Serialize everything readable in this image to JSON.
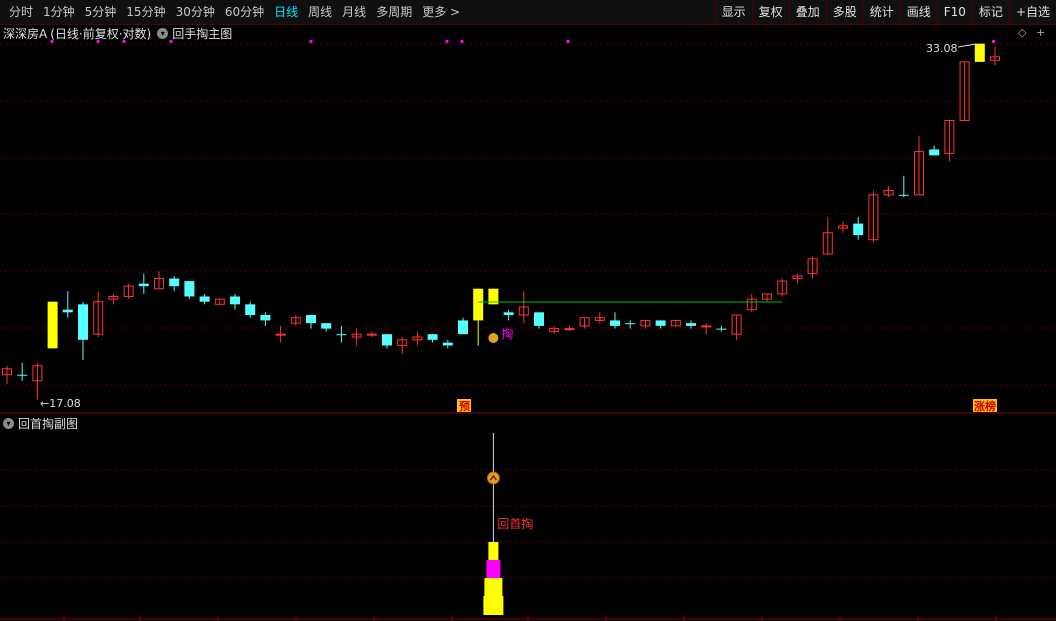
{
  "toolbar": {
    "periods": [
      "分时",
      "1分钟",
      "5分钟",
      "15分钟",
      "30分钟",
      "60分钟",
      "日线",
      "周线",
      "月线",
      "多周期",
      "更多 >"
    ],
    "active_period": "日线",
    "buttons": [
      "显示",
      "复权",
      "叠加",
      "多股",
      "统计",
      "画线",
      "F10",
      "标记",
      "+自选"
    ]
  },
  "main_panel": {
    "stock_name": "深深房A",
    "params": "(日线·前复权·对数)",
    "indicator_name": "回手掏主图",
    "indicator_icon": "chevron-down-icon"
  },
  "sub_panel": {
    "indicator_name": "回首掏副图",
    "indicator_icon": "chevron-down-icon",
    "signal_label": "回首掏"
  },
  "colors": {
    "up": "#ff3232",
    "down": "#54ffff",
    "highlight": "#ffff00",
    "magenta": "#ff00ff",
    "grid": "#5a0000",
    "line": "#00c000"
  },
  "chart_data": {
    "type": "candlestick",
    "scale": "log",
    "annotations": {
      "low_label": "17.08",
      "high_label": "33.08",
      "marker_yu": "预",
      "marker_zt": "涨榜",
      "mid_label": "掏"
    },
    "candles": [
      [
        17.9,
        18.1,
        17.6,
        18.2,
        "up"
      ],
      [
        17.9,
        17.9,
        17.7,
        18.3,
        "down"
      ],
      [
        17.7,
        18.2,
        17.1,
        18.3,
        "up"
      ],
      [
        18.8,
        20.5,
        18.8,
        20.5,
        "hl"
      ],
      [
        20.2,
        20.1,
        19.9,
        20.9,
        "down"
      ],
      [
        20.4,
        19.1,
        18.4,
        20.5,
        "down"
      ],
      [
        19.3,
        20.5,
        19.2,
        20.9,
        "up"
      ],
      [
        20.6,
        20.7,
        20.4,
        20.8,
        "up"
      ],
      [
        20.7,
        21.1,
        20.6,
        21.2,
        "up"
      ],
      [
        21.2,
        21.1,
        20.8,
        21.6,
        "down"
      ],
      [
        21.0,
        21.4,
        21.0,
        21.7,
        "up"
      ],
      [
        21.4,
        21.1,
        20.9,
        21.5,
        "down"
      ],
      [
        21.3,
        20.7,
        20.6,
        21.3,
        "down"
      ],
      [
        20.7,
        20.5,
        20.4,
        20.8,
        "down"
      ],
      [
        20.4,
        20.6,
        20.4,
        20.6,
        "up"
      ],
      [
        20.7,
        20.4,
        20.2,
        20.8,
        "down"
      ],
      [
        20.4,
        20.0,
        19.9,
        20.5,
        "down"
      ],
      [
        20.0,
        19.8,
        19.6,
        20.1,
        "down"
      ],
      [
        19.3,
        19.3,
        19.0,
        19.6,
        "up"
      ],
      [
        19.7,
        19.9,
        19.6,
        20.0,
        "up"
      ],
      [
        20.0,
        19.7,
        19.5,
        20.0,
        "down"
      ],
      [
        19.7,
        19.5,
        19.4,
        19.7,
        "down"
      ],
      [
        19.3,
        19.3,
        19.0,
        19.6,
        "down"
      ],
      [
        19.2,
        19.3,
        18.9,
        19.5,
        "up"
      ],
      [
        19.3,
        19.3,
        19.2,
        19.4,
        "up"
      ],
      [
        19.3,
        18.9,
        18.8,
        19.3,
        "down"
      ],
      [
        18.9,
        19.1,
        18.6,
        19.2,
        "up"
      ],
      [
        19.1,
        19.2,
        18.9,
        19.4,
        "up"
      ],
      [
        19.3,
        19.1,
        19.0,
        19.3,
        "down"
      ],
      [
        19.0,
        18.9,
        18.8,
        19.1,
        "down"
      ],
      [
        19.3,
        19.8,
        19.3,
        19.9,
        "down"
      ],
      [
        19.8,
        21.0,
        18.9,
        21.0,
        "hl"
      ],
      [
        21.0,
        20.4,
        20.4,
        21.0,
        "hl"
      ],
      [
        20.0,
        20.1,
        19.8,
        20.2,
        "down"
      ],
      [
        20.0,
        20.3,
        19.7,
        20.9,
        "up"
      ],
      [
        20.1,
        19.6,
        19.5,
        20.1,
        "down"
      ],
      [
        19.4,
        19.5,
        19.3,
        19.6,
        "up"
      ],
      [
        19.5,
        19.5,
        19.4,
        19.6,
        "up"
      ],
      [
        19.6,
        19.9,
        19.5,
        19.9,
        "up"
      ],
      [
        19.8,
        19.9,
        19.7,
        20.1,
        "up"
      ],
      [
        19.8,
        19.6,
        19.5,
        20.1,
        "down"
      ],
      [
        19.7,
        19.7,
        19.5,
        19.8,
        "down"
      ],
      [
        19.6,
        19.8,
        19.5,
        19.8,
        "up"
      ],
      [
        19.8,
        19.6,
        19.5,
        19.8,
        "down"
      ],
      [
        19.6,
        19.8,
        19.6,
        19.8,
        "up"
      ],
      [
        19.7,
        19.6,
        19.5,
        19.8,
        "down"
      ],
      [
        19.6,
        19.6,
        19.3,
        19.7,
        "up"
      ],
      [
        19.5,
        19.5,
        19.4,
        19.6,
        "down"
      ],
      [
        19.3,
        20.0,
        19.1,
        20.0,
        "up"
      ],
      [
        20.2,
        20.6,
        20.1,
        20.8,
        "up"
      ],
      [
        20.6,
        20.8,
        20.5,
        20.8,
        "up"
      ],
      [
        20.8,
        21.3,
        20.7,
        21.4,
        "up"
      ],
      [
        21.4,
        21.5,
        21.2,
        21.6,
        "up"
      ],
      [
        21.6,
        22.2,
        21.4,
        22.3,
        "up"
      ],
      [
        22.4,
        23.3,
        22.4,
        24.0,
        "up"
      ],
      [
        23.5,
        23.6,
        23.3,
        23.8,
        "up"
      ],
      [
        23.7,
        23.2,
        23.0,
        24.0,
        "down"
      ],
      [
        23.0,
        25.0,
        22.9,
        25.2,
        "up"
      ],
      [
        25.0,
        25.2,
        24.9,
        25.4,
        "up"
      ],
      [
        25.0,
        25.0,
        24.9,
        25.9,
        "down"
      ],
      [
        25.0,
        27.1,
        25.0,
        27.9,
        "up"
      ],
      [
        27.2,
        26.9,
        26.9,
        27.4,
        "down"
      ],
      [
        27.0,
        28.7,
        26.6,
        28.7,
        "up"
      ],
      [
        28.7,
        32.0,
        28.7,
        32.0,
        "up"
      ],
      [
        32.0,
        33.1,
        32.0,
        33.1,
        "hl"
      ],
      [
        32.3,
        32.1,
        31.8,
        32.9,
        "up"
      ]
    ],
    "dots_top": [
      52,
      98,
      124,
      171,
      311,
      447,
      462,
      568
    ],
    "sub_bars": [
      {
        "index": 32,
        "value": 1.0,
        "color": "yellow"
      },
      {
        "index": 32,
        "value": 0.55,
        "color": "magenta"
      }
    ]
  }
}
